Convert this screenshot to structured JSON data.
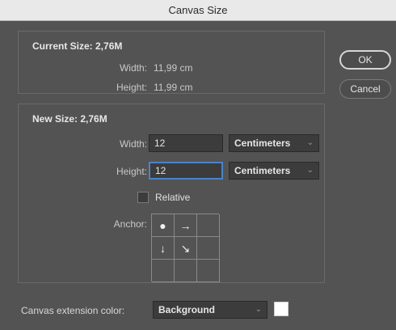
{
  "window": {
    "title": "Canvas Size"
  },
  "current_size": {
    "title": "Current Size: 2,76M",
    "width_label": "Width:",
    "width_value": "11,99 cm",
    "height_label": "Height:",
    "height_value": "11,99 cm"
  },
  "new_size": {
    "title": "New Size: 2,76M",
    "width_label": "Width:",
    "width_value": "12",
    "width_unit": "Centimeters",
    "height_label": "Height:",
    "height_value": "12",
    "height_unit": "Centimeters",
    "relative_label": "Relative",
    "relative_checked": false,
    "anchor_label": "Anchor:",
    "anchor": {
      "cells": [
        "●",
        "→",
        "",
        "↓",
        "↘",
        "",
        "",
        "",
        ""
      ],
      "icons": [
        "anchor-center-dot-icon",
        "arrow-right-icon",
        "",
        "arrow-down-icon",
        "arrow-down-right-icon",
        "",
        "",
        "",
        ""
      ]
    }
  },
  "buttons": {
    "ok": "OK",
    "cancel": "Cancel"
  },
  "extension_color": {
    "label": "Canvas extension color:",
    "value": "Background",
    "swatch_color": "#ffffff"
  }
}
